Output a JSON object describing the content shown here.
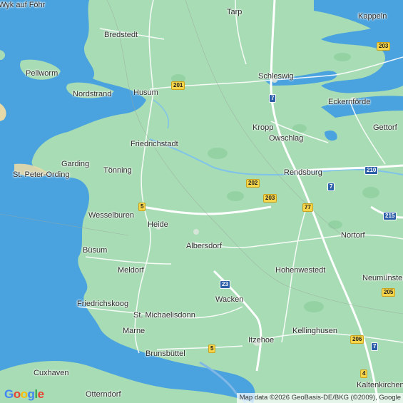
{
  "map": {
    "places": [
      {
        "id": "wyk-auf-fohr",
        "label": "Wyk auf Föhr"
      },
      {
        "id": "tarp",
        "label": "Tarp"
      },
      {
        "id": "kappeln",
        "label": "Kappeln"
      },
      {
        "id": "bredstedt",
        "label": "Bredstedt"
      },
      {
        "id": "pellworm",
        "label": "Pellworm"
      },
      {
        "id": "schleswig",
        "label": "Schleswig"
      },
      {
        "id": "nordstrand",
        "label": "Nordstrand"
      },
      {
        "id": "husum",
        "label": "Husum"
      },
      {
        "id": "eckernforde",
        "label": "Eckernförde"
      },
      {
        "id": "kropp",
        "label": "Kropp"
      },
      {
        "id": "gettorf",
        "label": "Gettorf"
      },
      {
        "id": "owschlag",
        "label": "Owschlag"
      },
      {
        "id": "friedrichstadt",
        "label": "Friedrichstadt"
      },
      {
        "id": "garding",
        "label": "Garding"
      },
      {
        "id": "tonning",
        "label": "Tönning"
      },
      {
        "id": "st-peter-ording",
        "label": "St. Peter-Ording"
      },
      {
        "id": "rendsburg",
        "label": "Rendsburg"
      },
      {
        "id": "wesselburen",
        "label": "Wesselburen"
      },
      {
        "id": "heide",
        "label": "Heide"
      },
      {
        "id": "nortorf",
        "label": "Nortorf"
      },
      {
        "id": "albersdorf",
        "label": "Albersdorf"
      },
      {
        "id": "busum",
        "label": "Büsum"
      },
      {
        "id": "meldorf",
        "label": "Meldorf"
      },
      {
        "id": "hohenwestedt",
        "label": "Hohenwestedt"
      },
      {
        "id": "neumunster",
        "label": "Neumünster"
      },
      {
        "id": "friedrichskoog",
        "label": "Friedrichskoog"
      },
      {
        "id": "wacken",
        "label": "Wacken"
      },
      {
        "id": "st-michaelisdonn",
        "label": "St. Michaelisdonn"
      },
      {
        "id": "marne",
        "label": "Marne"
      },
      {
        "id": "kellinghusen",
        "label": "Kellinghusen"
      },
      {
        "id": "itzehoe",
        "label": "Itzehoe"
      },
      {
        "id": "brunsbuttel",
        "label": "Brunsbüttel"
      },
      {
        "id": "kaltenkirchen",
        "label": "Kaltenkirchen"
      },
      {
        "id": "cuxhaven",
        "label": "Cuxhaven"
      },
      {
        "id": "otterndorf",
        "label": "Otterndorf"
      }
    ],
    "road_shields": [
      {
        "id": "b203-kappeln",
        "label": "203",
        "kind": "federal"
      },
      {
        "id": "b201",
        "label": "201",
        "kind": "federal"
      },
      {
        "id": "a7-north",
        "label": "7",
        "kind": "autobahn"
      },
      {
        "id": "b202",
        "label": "202",
        "kind": "federal"
      },
      {
        "id": "a210",
        "label": "210",
        "kind": "autobahn"
      },
      {
        "id": "a7-rendsburg",
        "label": "7",
        "kind": "autobahn"
      },
      {
        "id": "b203-rendsburg",
        "label": "203",
        "kind": "federal"
      },
      {
        "id": "b77",
        "label": "77",
        "kind": "federal"
      },
      {
        "id": "b5-north",
        "label": "5",
        "kind": "federal"
      },
      {
        "id": "a215",
        "label": "215",
        "kind": "autobahn"
      },
      {
        "id": "a23",
        "label": "23",
        "kind": "autobahn"
      },
      {
        "id": "b205",
        "label": "205",
        "kind": "federal"
      },
      {
        "id": "b206",
        "label": "206",
        "kind": "federal"
      },
      {
        "id": "a7-south",
        "label": "7",
        "kind": "autobahn"
      },
      {
        "id": "b5-south",
        "label": "5",
        "kind": "federal"
      },
      {
        "id": "b4",
        "label": "4",
        "kind": "federal"
      }
    ],
    "logo_text": "Google",
    "attribution": "Map data ©2026 GeoBasis-DE/BKG (©2009), Google",
    "colors": {
      "land": "#a8dcb4",
      "water": "#4aa3df",
      "highway": "#ffffff",
      "federal_shield": "#f7d54b",
      "autobahn_shield": "#2d5ea8"
    }
  }
}
